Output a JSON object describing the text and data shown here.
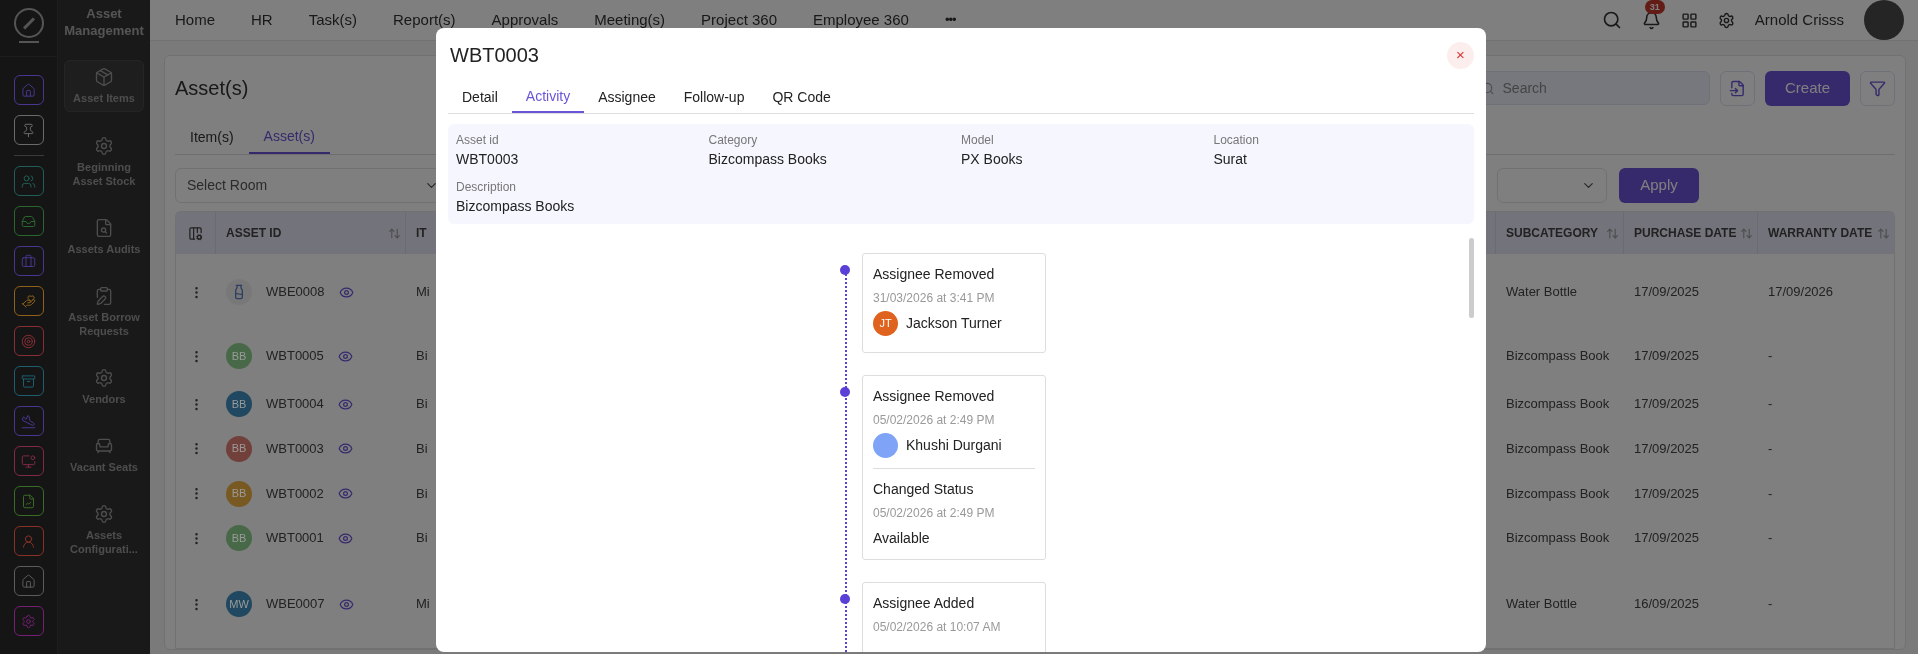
{
  "rail": [
    {
      "color": "#4a3590"
    },
    {
      "color": "#6a6a6a"
    },
    {
      "color": "#205f58"
    },
    {
      "color": "#2a672e"
    },
    {
      "color": "#4a3590"
    },
    {
      "color": "#916118"
    },
    {
      "color": "#8a2e35"
    },
    {
      "color": "#1c5f6e"
    },
    {
      "color": "#4a3590"
    },
    {
      "color": "#812949"
    },
    {
      "color": "#386d25"
    },
    {
      "color": "#8a3127"
    },
    {
      "color": "#5c5c5c"
    },
    {
      "color": "#761f75"
    }
  ],
  "module": {
    "title": "Asset Management",
    "items": [
      {
        "label": "Asset Items",
        "selected": true
      },
      {
        "label": "Beginning Asset Stock",
        "selected": false
      },
      {
        "label": "Assets Audits",
        "selected": false
      },
      {
        "label": "Asset Borrow Requests",
        "selected": false
      },
      {
        "label": "Vendors",
        "selected": false
      },
      {
        "label": "Vacant Seats",
        "selected": false
      },
      {
        "label": "Assets Configurati...",
        "selected": false
      }
    ]
  },
  "topnav": {
    "items": [
      "Home",
      "HR",
      "Task(s)",
      "Report(s)",
      "Approvals",
      "Meeting(s)",
      "Project 360",
      "Employee 360"
    ],
    "more": "•••",
    "notifications": "31",
    "user": "Arnold Crisss"
  },
  "page": {
    "title": "Asset(s)",
    "search": {
      "placeholder": "Search"
    },
    "create": "Create",
    "tabs": [
      {
        "label": "Item(s)",
        "selected": false
      },
      {
        "label": "Asset(s)",
        "selected": true
      }
    ],
    "room_select": {
      "placeholder": "Select Room"
    },
    "apply": "Apply",
    "table": {
      "columns": [
        {
          "label": "ASSET ID",
          "sortable": true
        },
        {
          "label": "IT",
          "sortable": false
        },
        {
          "label": "SUBCATEGORY",
          "sortable": true
        },
        {
          "label": "PURCHASE DATE",
          "sortable": true
        },
        {
          "label": "WARRANTY DATE",
          "sortable": true
        }
      ],
      "rows": [
        {
          "avatar": {
            "kind": "photo"
          },
          "asset_id": "WBE0008",
          "column_2": "Mi",
          "subcategory": "Water Bottle",
          "purchase_date": "17/09/2025",
          "warranty_date": "17/09/2026"
        },
        {
          "avatar": {
            "kind": "initials",
            "initials": "BB",
            "color": "#486948"
          },
          "asset_id": "WBT0005",
          "column_2": "Bi",
          "subcategory": "Bizcompass Book",
          "purchase_date": "17/09/2025",
          "warranty_date": "-"
        },
        {
          "avatar": {
            "kind": "initials",
            "initials": "BB",
            "color": "#204860"
          },
          "asset_id": "WBT0004",
          "column_2": "Bi",
          "subcategory": "Bizcompass Book",
          "purchase_date": "17/09/2025",
          "warranty_date": "-"
        },
        {
          "avatar": {
            "kind": "initials",
            "initials": "BB",
            "color": "#72403a"
          },
          "asset_id": "WBT0003",
          "column_2": "Bi",
          "subcategory": "Bizcompass Book",
          "purchase_date": "17/09/2025",
          "warranty_date": "-"
        },
        {
          "avatar": {
            "kind": "initials",
            "initials": "BB",
            "color": "#795922"
          },
          "asset_id": "WBT0002",
          "column_2": "Bi",
          "subcategory": "Bizcompass Book",
          "purchase_date": "17/09/2025",
          "warranty_date": "-"
        },
        {
          "avatar": {
            "kind": "initials",
            "initials": "BB",
            "color": "#486948"
          },
          "asset_id": "WBT0001",
          "column_2": "Bi",
          "subcategory": "Bizcompass Book",
          "purchase_date": "17/09/2025",
          "warranty_date": "-"
        },
        {
          "avatar": {
            "kind": "initials",
            "initials": "MW",
            "color": "#204860"
          },
          "asset_id": "WBE0007",
          "column_2": "Mi",
          "subcategory": "Water Bottle",
          "purchase_date": "16/09/2025",
          "warranty_date": "-"
        }
      ]
    }
  },
  "modal": {
    "title": "WBT0003",
    "close": "×",
    "tabs": [
      {
        "label": "Detail",
        "selected": false
      },
      {
        "label": "Activity",
        "selected": true
      },
      {
        "label": "Assignee",
        "selected": false
      },
      {
        "label": "Follow-up",
        "selected": false
      },
      {
        "label": "QR Code",
        "selected": false
      }
    ],
    "details": [
      {
        "label": "Asset id",
        "value": "WBT0003"
      },
      {
        "label": "Category",
        "value": "Bizcompass Books"
      },
      {
        "label": "Model",
        "value": "PX Books"
      },
      {
        "label": "Location",
        "value": "Surat"
      },
      {
        "label": "Description",
        "value": "Bizcompass Books"
      }
    ],
    "timeline": [
      {
        "entries": [
          {
            "kind": "person",
            "title": "Assignee Removed",
            "time": "31/03/2026 at 3:41 PM",
            "person": {
              "name": "Jackson Turner",
              "initials": "JT",
              "color": "#e0621f"
            }
          }
        ]
      },
      {
        "entries": [
          {
            "kind": "person",
            "title": "Assignee Removed",
            "time": "05/02/2026 at 2:49 PM",
            "person": {
              "name": "Khushi Durgani",
              "color": "#7ea3f7"
            }
          },
          {
            "kind": "status",
            "title": "Changed Status",
            "time": "05/02/2026 at 2:49 PM",
            "status": "Available"
          }
        ]
      },
      {
        "entries": [
          {
            "kind": "plain",
            "title": "Assignee Added",
            "time": "05/02/2026 at 10:07 AM"
          }
        ]
      }
    ]
  }
}
